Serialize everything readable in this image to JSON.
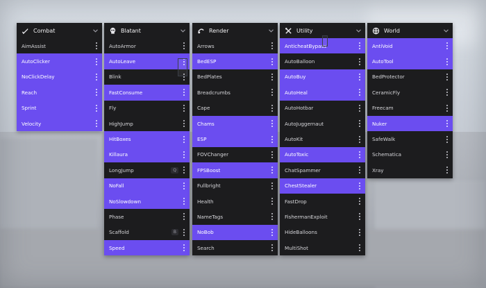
{
  "panels": [
    {
      "title": "Combat",
      "icon": "sword-icon",
      "items": [
        {
          "label": "AimAssist",
          "on": false
        },
        {
          "label": "AutoClicker",
          "on": true
        },
        {
          "label": "NoClickDelay",
          "on": true
        },
        {
          "label": "Reach",
          "on": true
        },
        {
          "label": "Sprint",
          "on": true
        },
        {
          "label": "Velocity",
          "on": true
        }
      ]
    },
    {
      "title": "Blatant",
      "icon": "skull-icon",
      "items": [
        {
          "label": "AutoArmor",
          "on": false
        },
        {
          "label": "AutoLeave",
          "on": true
        },
        {
          "label": "Blink",
          "on": false
        },
        {
          "label": "FastConsume",
          "on": true
        },
        {
          "label": "Fly",
          "on": false
        },
        {
          "label": "HighJump",
          "on": false
        },
        {
          "label": "HitBoxes",
          "on": true
        },
        {
          "label": "Killaura",
          "on": true
        },
        {
          "label": "LongJump",
          "on": false,
          "key": "Q"
        },
        {
          "label": "NoFall",
          "on": true
        },
        {
          "label": "NoSlowdown",
          "on": true
        },
        {
          "label": "Phase",
          "on": false
        },
        {
          "label": "Scaffold",
          "on": false,
          "key": "B"
        },
        {
          "label": "Speed",
          "on": true
        }
      ]
    },
    {
      "title": "Render",
      "icon": "render-icon",
      "items": [
        {
          "label": "Arrows",
          "on": false
        },
        {
          "label": "BedESP",
          "on": true
        },
        {
          "label": "BedPlates",
          "on": false
        },
        {
          "label": "Breadcrumbs",
          "on": false
        },
        {
          "label": "Cape",
          "on": false
        },
        {
          "label": "Chams",
          "on": true
        },
        {
          "label": "ESP",
          "on": true
        },
        {
          "label": "FOVChanger",
          "on": false
        },
        {
          "label": "FPSBoost",
          "on": true
        },
        {
          "label": "Fullbright",
          "on": false
        },
        {
          "label": "Health",
          "on": false
        },
        {
          "label": "NameTags",
          "on": false
        },
        {
          "label": "NoBob",
          "on": true
        },
        {
          "label": "Search",
          "on": false
        }
      ]
    },
    {
      "title": "Utility",
      "icon": "tools-icon",
      "items": [
        {
          "label": "AnticheatBypass",
          "on": true
        },
        {
          "label": "AutoBalloon",
          "on": false
        },
        {
          "label": "AutoBuy",
          "on": true
        },
        {
          "label": "AutoHeal",
          "on": true
        },
        {
          "label": "AutoHotbar",
          "on": false
        },
        {
          "label": "AutoJuggernaut",
          "on": false
        },
        {
          "label": "AutoKit",
          "on": false
        },
        {
          "label": "AutoToxic",
          "on": true
        },
        {
          "label": "ChatSpammer",
          "on": false
        },
        {
          "label": "ChestStealer",
          "on": true
        },
        {
          "label": "FastDrop",
          "on": false
        },
        {
          "label": "FishermanExploit",
          "on": false
        },
        {
          "label": "HideBalloons",
          "on": false
        },
        {
          "label": "MultiShot",
          "on": false
        }
      ]
    },
    {
      "title": "World",
      "icon": "globe-icon",
      "items": [
        {
          "label": "AntiVoid",
          "on": true
        },
        {
          "label": "AutoTool",
          "on": true
        },
        {
          "label": "BedProtector",
          "on": false
        },
        {
          "label": "CeramicFly",
          "on": false
        },
        {
          "label": "Freecam",
          "on": false
        },
        {
          "label": "Nuker",
          "on": true
        },
        {
          "label": "SafeWalk",
          "on": false
        },
        {
          "label": "Schematica",
          "on": false
        },
        {
          "label": "Xray",
          "on": false
        }
      ]
    }
  ],
  "colors": {
    "accent": "#6b4df0",
    "panel": "#1c1c1e"
  }
}
